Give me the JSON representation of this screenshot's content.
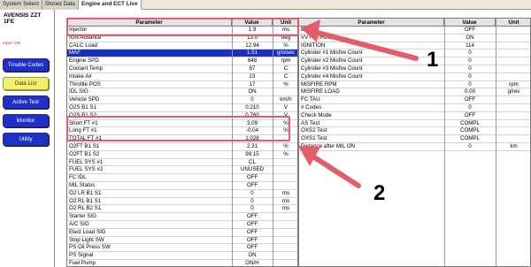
{
  "tabs": [
    {
      "label": "System Select"
    },
    {
      "label": "Stored Data"
    },
    {
      "label": "Engine and ECT Live"
    }
  ],
  "vehicle": {
    "line1": "AVENSIS ZZT",
    "line2": "1FE",
    "vin_label": "Input VIN"
  },
  "sidebar": {
    "buttons": [
      {
        "label": "Trouble Codes"
      },
      {
        "label": "Data List"
      },
      {
        "label": "Active Test"
      },
      {
        "label": "Monitor"
      },
      {
        "label": "Utility"
      }
    ]
  },
  "left_table": {
    "headers": {
      "param": "Parameter",
      "value": "Value",
      "unit": "Unit"
    },
    "rows": [
      {
        "param": "Injector",
        "value": "1.9",
        "unit": "ms"
      },
      {
        "param": "IGN Advance",
        "value": "13.0",
        "unit": "deg"
      },
      {
        "param": "CALC Load",
        "value": "12.94",
        "unit": "%"
      },
      {
        "param": "MAF",
        "value": "1.51",
        "unit": "gm/sec"
      },
      {
        "param": "Engine SPD",
        "value": "648",
        "unit": "rpm"
      },
      {
        "param": "Coolant Temp",
        "value": "87",
        "unit": "C"
      },
      {
        "param": "Intake Air",
        "value": "23",
        "unit": "C"
      },
      {
        "param": "Throttle POS",
        "value": "17",
        "unit": "%"
      },
      {
        "param": "IDL SIG",
        "value": "ON",
        "unit": ""
      },
      {
        "param": "Vehicle SPD",
        "value": "0",
        "unit": "km/h"
      },
      {
        "param": "O2S B1 S1",
        "value": "0.210",
        "unit": "V"
      },
      {
        "param": "O2S B1 S2",
        "value": "0.760",
        "unit": "V"
      },
      {
        "param": "Short FT #1",
        "value": "3.09",
        "unit": "%"
      },
      {
        "param": "Long FT #1",
        "value": "-0.04",
        "unit": "%"
      },
      {
        "param": "TOTAL FT #1",
        "value": "1.028",
        "unit": ""
      },
      {
        "param": "O2FT B1 S1",
        "value": "2.31",
        "unit": "%"
      },
      {
        "param": "O2FT B1 S2",
        "value": "99.15",
        "unit": "%"
      },
      {
        "param": "FUEL SYS #1",
        "value": "CL",
        "unit": ""
      },
      {
        "param": "FUEL SYS #2",
        "value": "UNUSED",
        "unit": ""
      },
      {
        "param": "FC IDL",
        "value": "OFF",
        "unit": ""
      },
      {
        "param": "MIL Status",
        "value": "OFF",
        "unit": ""
      },
      {
        "param": "O2 LR B1 S1",
        "value": "0",
        "unit": "ms"
      },
      {
        "param": "O2 RL B1 S1",
        "value": "0",
        "unit": "ms"
      },
      {
        "param": "O2 RL B2 S1",
        "value": "0",
        "unit": "ms"
      },
      {
        "param": "Starter SIG",
        "value": "OFF",
        "unit": ""
      },
      {
        "param": "A/C SIG",
        "value": "OFF",
        "unit": ""
      },
      {
        "param": "Elect Load SIG",
        "value": "OFF",
        "unit": ""
      },
      {
        "param": "Stop Light SW",
        "value": "OFF",
        "unit": ""
      },
      {
        "param": "PS Oil Press SW",
        "value": "OFF",
        "unit": ""
      },
      {
        "param": "PS Signal",
        "value": "ON",
        "unit": ""
      },
      {
        "param": "Fuel Pump",
        "value": "ON/H",
        "unit": ""
      }
    ]
  },
  "right_table": {
    "headers": {
      "param": "Parameter",
      "value": "Value",
      "unit": "Unit"
    },
    "rows": [
      {
        "param": "EVAP",
        "value": "OFF",
        "unit": ""
      },
      {
        "param": "VVT CTRL B1",
        "value": "ON",
        "unit": ""
      },
      {
        "param": "IGNITION",
        "value": "114",
        "unit": ""
      },
      {
        "param": "Cylinder #1 Misfire Count",
        "value": "0",
        "unit": ""
      },
      {
        "param": "Cylinder #2 Misfire Count",
        "value": "0",
        "unit": ""
      },
      {
        "param": "Cylinder #3 Misfire Count",
        "value": "0",
        "unit": ""
      },
      {
        "param": "Cylinder #4 Misfire Count",
        "value": "0",
        "unit": ""
      },
      {
        "param": "MISFIRE RPM",
        "value": "0",
        "unit": "rpm"
      },
      {
        "param": "MISFIRE LOAD",
        "value": "0.00",
        "unit": "g/rev"
      },
      {
        "param": "FC TAU",
        "value": "OFF",
        "unit": ""
      },
      {
        "param": "# Codes",
        "value": "0",
        "unit": ""
      },
      {
        "param": "Check Mode",
        "value": "OFF",
        "unit": ""
      },
      {
        "param": "AS Test",
        "value": "COMPL",
        "unit": ""
      },
      {
        "param": "OXS2 Test",
        "value": "COMPL",
        "unit": ""
      },
      {
        "param": "OXS1 Test",
        "value": "COMPL",
        "unit": ""
      },
      {
        "param": "Distance after MIL ON",
        "value": "0",
        "unit": "km"
      }
    ]
  },
  "annotations": {
    "label_1": "1",
    "label_2": "2"
  },
  "colors": {
    "highlight_row": "#1a2fbc",
    "sidebar_button": "#1f30c8",
    "sidebar_selected": "#f2ef6a",
    "annotation_box": "#e35c6a"
  }
}
